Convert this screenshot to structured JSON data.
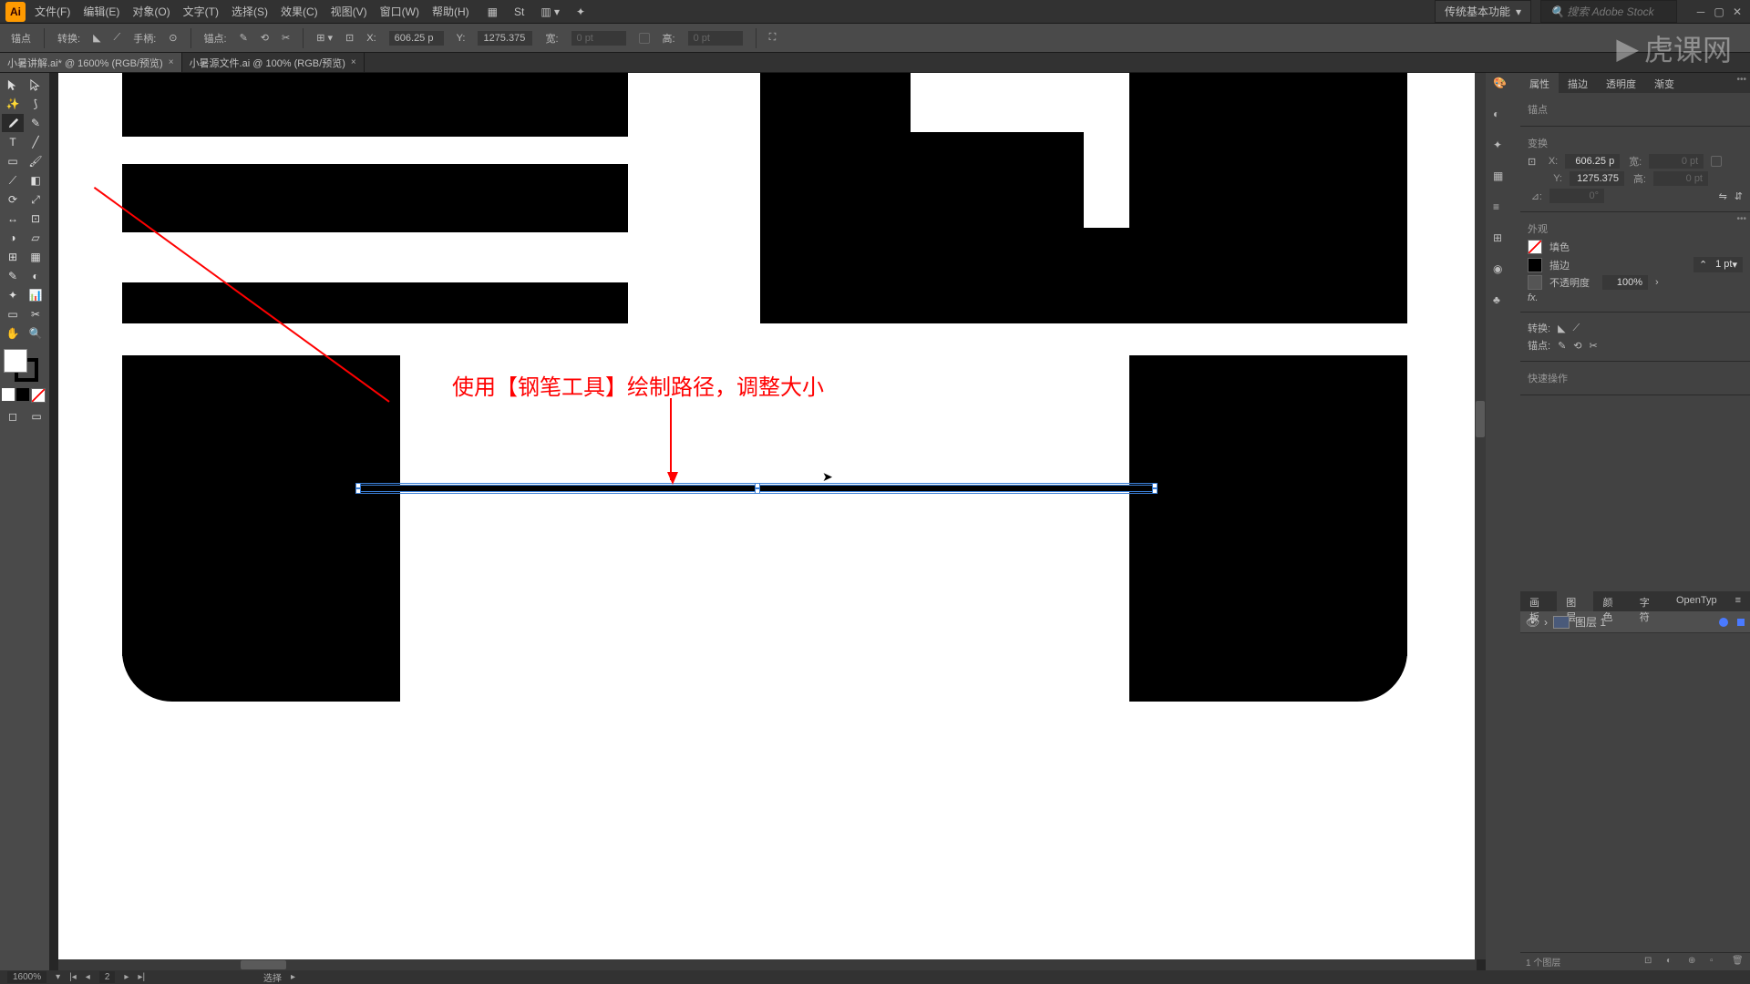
{
  "menu": {
    "file": "文件(F)",
    "edit": "编辑(E)",
    "object": "对象(O)",
    "type": "文字(T)",
    "select": "选择(S)",
    "effect": "效果(C)",
    "view": "视图(V)",
    "window": "窗口(W)",
    "help": "帮助(H)"
  },
  "workspace": "传统基本功能",
  "search_placeholder": "搜索 Adobe Stock",
  "controlbar": {
    "anchor": "锚点",
    "convert": "转换:",
    "handle": "手柄:",
    "anchors": "锚点:",
    "x_lbl": "X:",
    "x_val": "606.25 p",
    "y_lbl": "Y:",
    "y_val": "1275.375",
    "w_lbl": "宽:",
    "w_val": "0 pt",
    "h_lbl": "高:",
    "h_val": "0 pt"
  },
  "tabs": {
    "active": "小暑讲解.ai* @ 1600% (RGB/预览)",
    "inactive": "小暑源文件.ai @ 100% (RGB/预览)"
  },
  "annotation": "使用【钢笔工具】绘制路径，调整大小",
  "properties": {
    "tab_props": "属性",
    "tab_stroke": "描边",
    "tab_transparency": "透明度",
    "tab_gradient": "渐变",
    "anchor_title": "锚点",
    "transform_title": "变换",
    "x_lbl": "X:",
    "x_val": "606.25 p",
    "w_lbl": "宽:",
    "w_val": "0 pt",
    "y_lbl": "Y:",
    "y_val": "1275.375",
    "h_lbl": "高:",
    "h_val": "0 pt",
    "angle_lbl": "⊿:",
    "angle_val": "0°",
    "appearance_title": "外观",
    "fill_lbl": "填色",
    "stroke_lbl": "描边",
    "stroke_val": "1 pt",
    "opacity_lbl": "不透明度",
    "opacity_val": "100%",
    "fx_lbl": "fx.",
    "convert_title": "转换:",
    "anchor_title2": "锚点:",
    "quick_title": "快速操作"
  },
  "layerspanel": {
    "tab_artboard": "画板",
    "tab_layers": "图层",
    "tab_swatches": "颜色",
    "tab_char": "字符",
    "tab_ot": "OpenTyp",
    "layer1": "图层 1",
    "footer_count": "1 个图层"
  },
  "statusbar": {
    "zoom": "1600%",
    "artboard_nav": "2",
    "tool": "选择"
  },
  "watermark": "虎课网"
}
